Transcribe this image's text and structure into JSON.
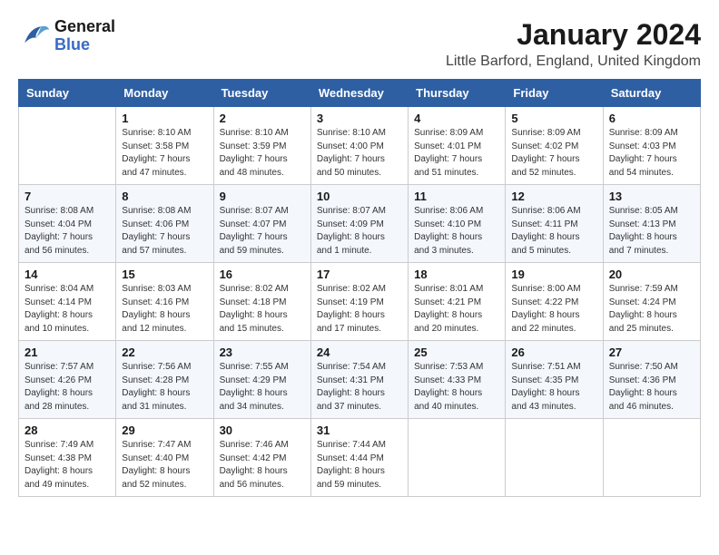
{
  "logo": {
    "line1": "General",
    "line2": "Blue"
  },
  "title": "January 2024",
  "subtitle": "Little Barford, England, United Kingdom",
  "headers": [
    "Sunday",
    "Monday",
    "Tuesday",
    "Wednesday",
    "Thursday",
    "Friday",
    "Saturday"
  ],
  "weeks": [
    [
      {
        "day": "",
        "info": ""
      },
      {
        "day": "1",
        "info": "Sunrise: 8:10 AM\nSunset: 3:58 PM\nDaylight: 7 hours\nand 47 minutes."
      },
      {
        "day": "2",
        "info": "Sunrise: 8:10 AM\nSunset: 3:59 PM\nDaylight: 7 hours\nand 48 minutes."
      },
      {
        "day": "3",
        "info": "Sunrise: 8:10 AM\nSunset: 4:00 PM\nDaylight: 7 hours\nand 50 minutes."
      },
      {
        "day": "4",
        "info": "Sunrise: 8:09 AM\nSunset: 4:01 PM\nDaylight: 7 hours\nand 51 minutes."
      },
      {
        "day": "5",
        "info": "Sunrise: 8:09 AM\nSunset: 4:02 PM\nDaylight: 7 hours\nand 52 minutes."
      },
      {
        "day": "6",
        "info": "Sunrise: 8:09 AM\nSunset: 4:03 PM\nDaylight: 7 hours\nand 54 minutes."
      }
    ],
    [
      {
        "day": "7",
        "info": "Sunrise: 8:08 AM\nSunset: 4:04 PM\nDaylight: 7 hours\nand 56 minutes."
      },
      {
        "day": "8",
        "info": "Sunrise: 8:08 AM\nSunset: 4:06 PM\nDaylight: 7 hours\nand 57 minutes."
      },
      {
        "day": "9",
        "info": "Sunrise: 8:07 AM\nSunset: 4:07 PM\nDaylight: 7 hours\nand 59 minutes."
      },
      {
        "day": "10",
        "info": "Sunrise: 8:07 AM\nSunset: 4:09 PM\nDaylight: 8 hours\nand 1 minute."
      },
      {
        "day": "11",
        "info": "Sunrise: 8:06 AM\nSunset: 4:10 PM\nDaylight: 8 hours\nand 3 minutes."
      },
      {
        "day": "12",
        "info": "Sunrise: 8:06 AM\nSunset: 4:11 PM\nDaylight: 8 hours\nand 5 minutes."
      },
      {
        "day": "13",
        "info": "Sunrise: 8:05 AM\nSunset: 4:13 PM\nDaylight: 8 hours\nand 7 minutes."
      }
    ],
    [
      {
        "day": "14",
        "info": "Sunrise: 8:04 AM\nSunset: 4:14 PM\nDaylight: 8 hours\nand 10 minutes."
      },
      {
        "day": "15",
        "info": "Sunrise: 8:03 AM\nSunset: 4:16 PM\nDaylight: 8 hours\nand 12 minutes."
      },
      {
        "day": "16",
        "info": "Sunrise: 8:02 AM\nSunset: 4:18 PM\nDaylight: 8 hours\nand 15 minutes."
      },
      {
        "day": "17",
        "info": "Sunrise: 8:02 AM\nSunset: 4:19 PM\nDaylight: 8 hours\nand 17 minutes."
      },
      {
        "day": "18",
        "info": "Sunrise: 8:01 AM\nSunset: 4:21 PM\nDaylight: 8 hours\nand 20 minutes."
      },
      {
        "day": "19",
        "info": "Sunrise: 8:00 AM\nSunset: 4:22 PM\nDaylight: 8 hours\nand 22 minutes."
      },
      {
        "day": "20",
        "info": "Sunrise: 7:59 AM\nSunset: 4:24 PM\nDaylight: 8 hours\nand 25 minutes."
      }
    ],
    [
      {
        "day": "21",
        "info": "Sunrise: 7:57 AM\nSunset: 4:26 PM\nDaylight: 8 hours\nand 28 minutes."
      },
      {
        "day": "22",
        "info": "Sunrise: 7:56 AM\nSunset: 4:28 PM\nDaylight: 8 hours\nand 31 minutes."
      },
      {
        "day": "23",
        "info": "Sunrise: 7:55 AM\nSunset: 4:29 PM\nDaylight: 8 hours\nand 34 minutes."
      },
      {
        "day": "24",
        "info": "Sunrise: 7:54 AM\nSunset: 4:31 PM\nDaylight: 8 hours\nand 37 minutes."
      },
      {
        "day": "25",
        "info": "Sunrise: 7:53 AM\nSunset: 4:33 PM\nDaylight: 8 hours\nand 40 minutes."
      },
      {
        "day": "26",
        "info": "Sunrise: 7:51 AM\nSunset: 4:35 PM\nDaylight: 8 hours\nand 43 minutes."
      },
      {
        "day": "27",
        "info": "Sunrise: 7:50 AM\nSunset: 4:36 PM\nDaylight: 8 hours\nand 46 minutes."
      }
    ],
    [
      {
        "day": "28",
        "info": "Sunrise: 7:49 AM\nSunset: 4:38 PM\nDaylight: 8 hours\nand 49 minutes."
      },
      {
        "day": "29",
        "info": "Sunrise: 7:47 AM\nSunset: 4:40 PM\nDaylight: 8 hours\nand 52 minutes."
      },
      {
        "day": "30",
        "info": "Sunrise: 7:46 AM\nSunset: 4:42 PM\nDaylight: 8 hours\nand 56 minutes."
      },
      {
        "day": "31",
        "info": "Sunrise: 7:44 AM\nSunset: 4:44 PM\nDaylight: 8 hours\nand 59 minutes."
      },
      {
        "day": "",
        "info": ""
      },
      {
        "day": "",
        "info": ""
      },
      {
        "day": "",
        "info": ""
      }
    ]
  ]
}
